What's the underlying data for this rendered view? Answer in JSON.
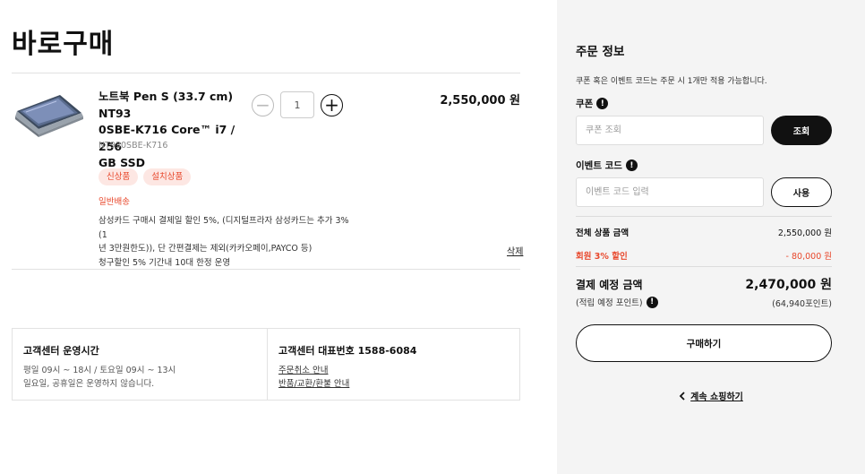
{
  "page": {
    "title": "바로구매"
  },
  "product": {
    "name": "노트북 Pen S (33.7 cm) NT930SBE-K716 Core™ i7 / 256 GB SSD",
    "name_lines": [
      "노트북 Pen S (33.7 cm) NT93",
      "0SBE-K716 Core™ i7 / 256",
      "GB SSD"
    ],
    "code": "NT930SBE-K716",
    "quantity": "1",
    "price": "2,550,000 원",
    "badges": [
      "신상품",
      "설치상품"
    ],
    "shipping": "일반배송",
    "benefit_lines": [
      "삼성카드 구매시 결제일 할인 5%, (디지털프라자 삼성카드는 추가 3%(1",
      "년 3만원한도)), 단 간편결제는 제외(카카오페이,PAYCO 등)",
      "청구할인 5% 기간내 10대 한정 운영"
    ],
    "delete_label": "삭제",
    "thumbnail_icon": "laptop-image"
  },
  "customer_center": {
    "hours_title": "고객센터 운영시간",
    "hours_lines": [
      "평일 09시 ~ 18시 / 토요일 09시 ~ 13시",
      "일요일, 공휴일은 운영하지 않습니다."
    ],
    "phone_title": "고객센터 대표번호 1588-6084",
    "links": [
      "주문취소 안내",
      "반품/교환/환불 안내"
    ]
  },
  "order_info": {
    "title": "주문 정보",
    "note": "쿠폰 혹은 이벤트 코드는 주문 시 1개만 적용 가능합니다.",
    "coupon_label": "쿠폰",
    "coupon_placeholder": "쿠폰 조회",
    "coupon_button": "조회",
    "event_label": "이벤트 코드",
    "event_placeholder": "이벤트 코드 입력",
    "event_button": "사용",
    "subtotal_label": "전체 상품 금액",
    "subtotal_value": "2,550,000 원",
    "discount_label": "회원 3% 할인",
    "discount_value": "- 80,000 원",
    "total_label": "결제 예정 금액",
    "total_value": "2,470,000 원",
    "points_label": "(적립 예정 포인트)",
    "points_value": "(64,940포인트)",
    "buy_button": "구매하기",
    "continue_label": "계속 쇼핑하기"
  },
  "colors": {
    "accent_red": "#e8472b",
    "badge_bg": "#fde7e3",
    "sidebar_bg": "#f4f4f4",
    "dark": "#111111"
  }
}
